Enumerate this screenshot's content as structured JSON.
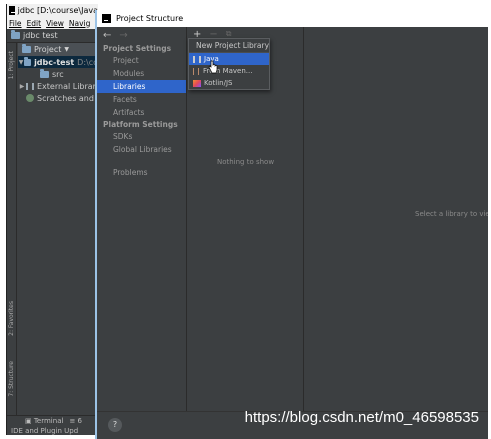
{
  "ide": {
    "title": "jdbc [D:\\course\\Java",
    "menu": [
      "File",
      "Edit",
      "View",
      "Navig"
    ],
    "navbar_project": "jdbc test",
    "project_dropdown": "Project",
    "tree": [
      {
        "label": "jdbc-test",
        "suffix": "D:\\co",
        "level": 0,
        "expanded": true
      },
      {
        "label": "src",
        "level": 1
      },
      {
        "label": "External Librar",
        "level": 0,
        "expanded": false
      },
      {
        "label": "Scratches and",
        "level": 0
      }
    ],
    "left_tabs": [
      "1: Project",
      "2: Favorites",
      "7: Structure"
    ],
    "bottom_tabs": [
      "Terminal",
      "6"
    ],
    "status": "IDE and Plugin Upd"
  },
  "dialog": {
    "title": "Project Structure",
    "sections": [
      {
        "title": "Project Settings",
        "items": [
          "Project",
          "Modules",
          "Libraries",
          "Facets",
          "Artifacts"
        ]
      },
      {
        "title": "Platform Settings",
        "items": [
          "SDKs",
          "Global Libraries"
        ]
      }
    ],
    "selected_item": "Libraries",
    "problems": "Problems",
    "middle_empty": "Nothing to show",
    "right_hint": "Select a library to view",
    "help": "?"
  },
  "popup": {
    "title": "New Project Library",
    "items": [
      {
        "label": "Java",
        "icon": "java-library-icon",
        "selected": true
      },
      {
        "label": "From Maven...",
        "icon": "maven-icon",
        "selected": false
      },
      {
        "label": "Kotlin/JS",
        "icon": "kotlin-icon",
        "selected": false
      }
    ]
  },
  "watermark": "https://blog.csdn.net/m0_46598535",
  "colors": {
    "selection": "#2f65ca",
    "panel_bg": "#3c3f41",
    "dialog_border": "#9cc3e6"
  }
}
